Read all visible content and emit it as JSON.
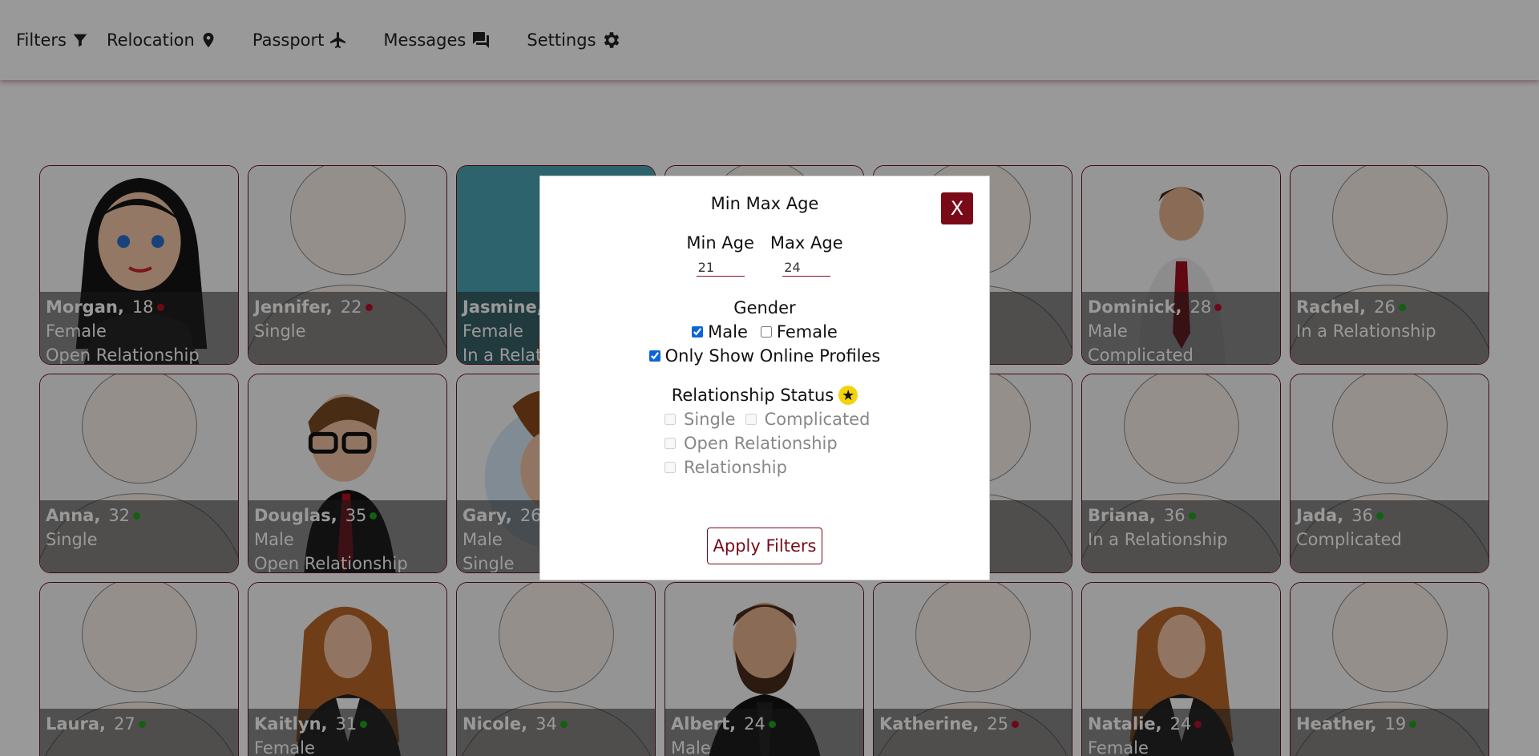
{
  "nav": {
    "items": [
      {
        "label": "Filters",
        "icon": "filter-icon"
      },
      {
        "label": "Relocation",
        "icon": "location-pin-icon"
      },
      {
        "label": "Passport",
        "icon": "airplane-icon"
      },
      {
        "label": "Messages",
        "icon": "chat-icon"
      },
      {
        "label": "Settings",
        "icon": "gear-icon"
      }
    ]
  },
  "colors": {
    "brand": "#7a0a18",
    "online": "#1fa01f",
    "offline": "#b5102a",
    "star": "#f2d30c"
  },
  "profiles": [
    {
      "name": "Morgan,",
      "age": "18",
      "online": false,
      "gender": "Female",
      "status": "Open Relationship",
      "avatar": "cartoon-woman"
    },
    {
      "name": "Jennifer,",
      "age": "22",
      "online": false,
      "gender": "",
      "status": "Single",
      "avatar": "placeholder"
    },
    {
      "name": "Jasmine,",
      "age": "",
      "online": false,
      "gender": "Female",
      "status": "In a Relationship",
      "avatar": "cartoon-woman-teal"
    },
    {
      "name": "",
      "age": "",
      "online": false,
      "gender": "",
      "status": "",
      "avatar": "placeholder"
    },
    {
      "name": "",
      "age": "",
      "online": false,
      "gender": "",
      "status": "",
      "avatar": "placeholder"
    },
    {
      "name": "Dominick,",
      "age": "28",
      "online": false,
      "gender": "Male",
      "status": "Complicated",
      "avatar": "businessman"
    },
    {
      "name": "Rachel,",
      "age": "26",
      "online": true,
      "gender": "",
      "status": "In a Relationship",
      "avatar": "placeholder"
    },
    {
      "name": "Anna,",
      "age": "32",
      "online": true,
      "gender": "",
      "status": "Single",
      "avatar": "placeholder"
    },
    {
      "name": "Douglas,",
      "age": "35",
      "online": true,
      "gender": "Male",
      "status": "Open Relationship",
      "avatar": "businessman-glasses"
    },
    {
      "name": "Gary,",
      "age": "26",
      "online": true,
      "gender": "Male",
      "status": "Single",
      "avatar": "cartoon-man"
    },
    {
      "name": "",
      "age": "",
      "online": false,
      "gender": "",
      "status": "",
      "avatar": "placeholder"
    },
    {
      "name": "",
      "age": "",
      "online": false,
      "gender": "",
      "status": "nship",
      "avatar": "placeholder"
    },
    {
      "name": "Briana,",
      "age": "36",
      "online": true,
      "gender": "",
      "status": "In a Relationship",
      "avatar": "placeholder"
    },
    {
      "name": "Jada,",
      "age": "36",
      "online": true,
      "gender": "",
      "status": "Complicated",
      "avatar": "placeholder"
    },
    {
      "name": "Laura,",
      "age": "27",
      "online": true,
      "gender": "",
      "status": "",
      "avatar": "placeholder"
    },
    {
      "name": "Kaitlyn,",
      "age": "31",
      "online": true,
      "gender": "Female",
      "status": "",
      "avatar": "businesswoman"
    },
    {
      "name": "Nicole,",
      "age": "34",
      "online": true,
      "gender": "",
      "status": "",
      "avatar": "placeholder"
    },
    {
      "name": "Albert,",
      "age": "24",
      "online": true,
      "gender": "Male",
      "status": "",
      "avatar": "bearded-man"
    },
    {
      "name": "Katherine,",
      "age": "25",
      "online": false,
      "gender": "",
      "status": "",
      "avatar": "placeholder"
    },
    {
      "name": "Natalie,",
      "age": "24",
      "online": false,
      "gender": "Female",
      "status": "",
      "avatar": "businesswoman"
    },
    {
      "name": "Heather,",
      "age": "19",
      "online": true,
      "gender": "",
      "status": "",
      "avatar": "placeholder"
    }
  ],
  "modal": {
    "title": "Min Max Age",
    "close_label": "X",
    "min_age_label": "Min Age",
    "max_age_label": "Max Age",
    "min_age_value": "21",
    "max_age_value": "24",
    "gender_title": "Gender",
    "male_label": "Male",
    "male_checked": true,
    "female_label": "Female",
    "female_checked": false,
    "online_only_label": "Only Show Online Profiles",
    "online_only_checked": true,
    "relationship_title": "Relationship Status",
    "relationship_options": [
      {
        "label": "Single",
        "checked": false
      },
      {
        "label": "Complicated",
        "checked": false
      },
      {
        "label": "Open Relationship",
        "checked": false
      },
      {
        "label": "Relationship",
        "checked": false
      }
    ],
    "apply_label": "Apply Filters"
  }
}
